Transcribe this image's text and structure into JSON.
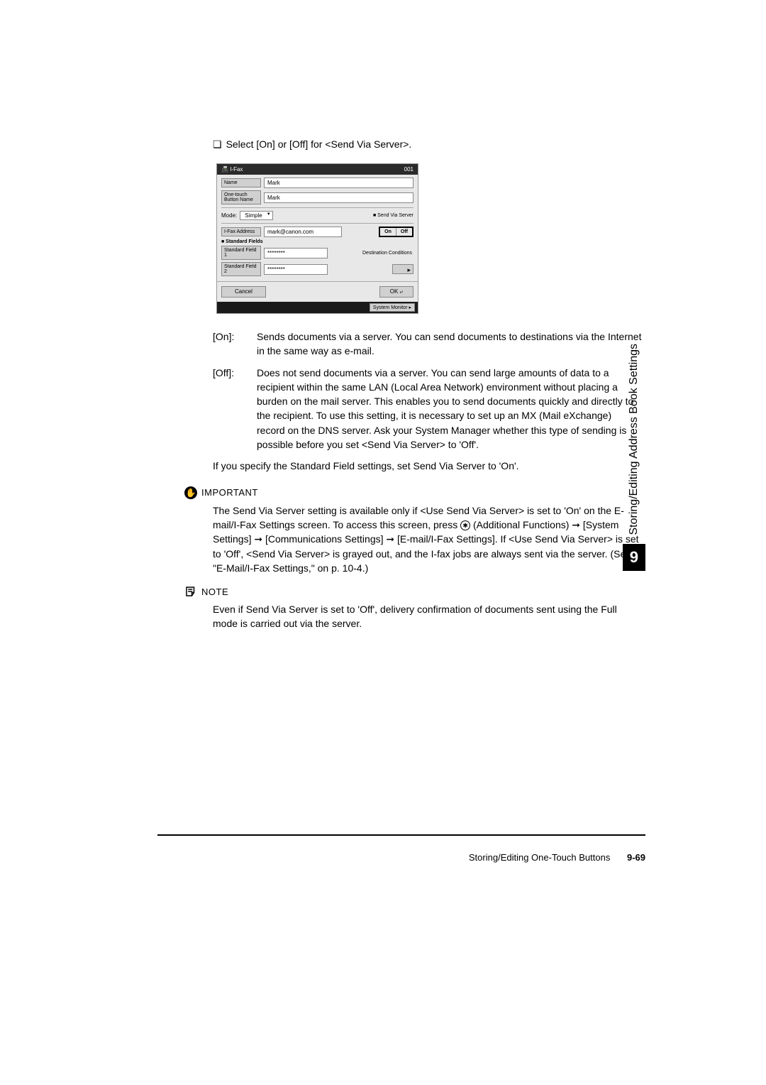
{
  "instruction": "Select [On] or [Off] for <Send Via Server>.",
  "ui": {
    "header_title": "I-Fax",
    "header_num": "001",
    "name_label": "Name",
    "name_value": "Mark",
    "onetouch_label": "One-touch Button Name",
    "onetouch_value": "Mark",
    "mode_label": "Mode:",
    "mode_value": "Simple",
    "sendvia_label": "■ Send Via Server",
    "on": "On",
    "off": "Off",
    "ifax_label": "I-Fax Address",
    "ifax_value": "mark@canon.com",
    "stdfields": "■ Standard Fields",
    "std1": "Standard Field 1",
    "std2": "Standard Field 2",
    "stars": "********",
    "dest": "Destination Conditions",
    "cancel": "Cancel",
    "ok": "OK",
    "sysmon": "System Monitor"
  },
  "defs": {
    "on_term": "[On]:",
    "on_desc": "Sends documents via a server. You can send documents to destinations via the Internet in the same way as e-mail.",
    "off_term": "[Off]:",
    "off_desc": "Does not send documents via a server. You can send large amounts of data to a recipient within the same LAN (Local Area Network) environment without placing a burden on the mail server. This enables you to send documents quickly and directly to the recipient. To use this setting, it is necessary to set up an MX (Mail eXchange) record on the DNS server. Ask your System Manager whether this type of sending is possible before you set <Send Via Server> to 'Off'."
  },
  "followup": "If you specify the Standard Field settings, set Send Via Server to 'On'.",
  "important": {
    "title": "IMPORTANT",
    "body_pre": "The Send Via Server setting is available only if <Use Send Via Server> is set to 'On' on the E-mail/I-Fax Settings screen. To access this screen, press ",
    "body_post": " (Additional Functions) ➞ [System Settings] ➞ [Communications Settings] ➞ [E-mail/I-Fax Settings]. If <Use Send Via Server> is set to 'Off', <Send Via Server> is grayed out, and the I-fax jobs are always sent via the server. (See \"E-Mail/I-Fax Settings,\" on p. 10-4.)"
  },
  "note": {
    "title": "NOTE",
    "body": "Even if Send Via Server is set to 'Off', delivery confirmation of documents sent using the Full mode is carried out via the server."
  },
  "side": {
    "text": "Storing/Editing Address Book Settings",
    "num": "9"
  },
  "footer": {
    "text": "Storing/Editing One-Touch Buttons",
    "page": "9-69"
  }
}
